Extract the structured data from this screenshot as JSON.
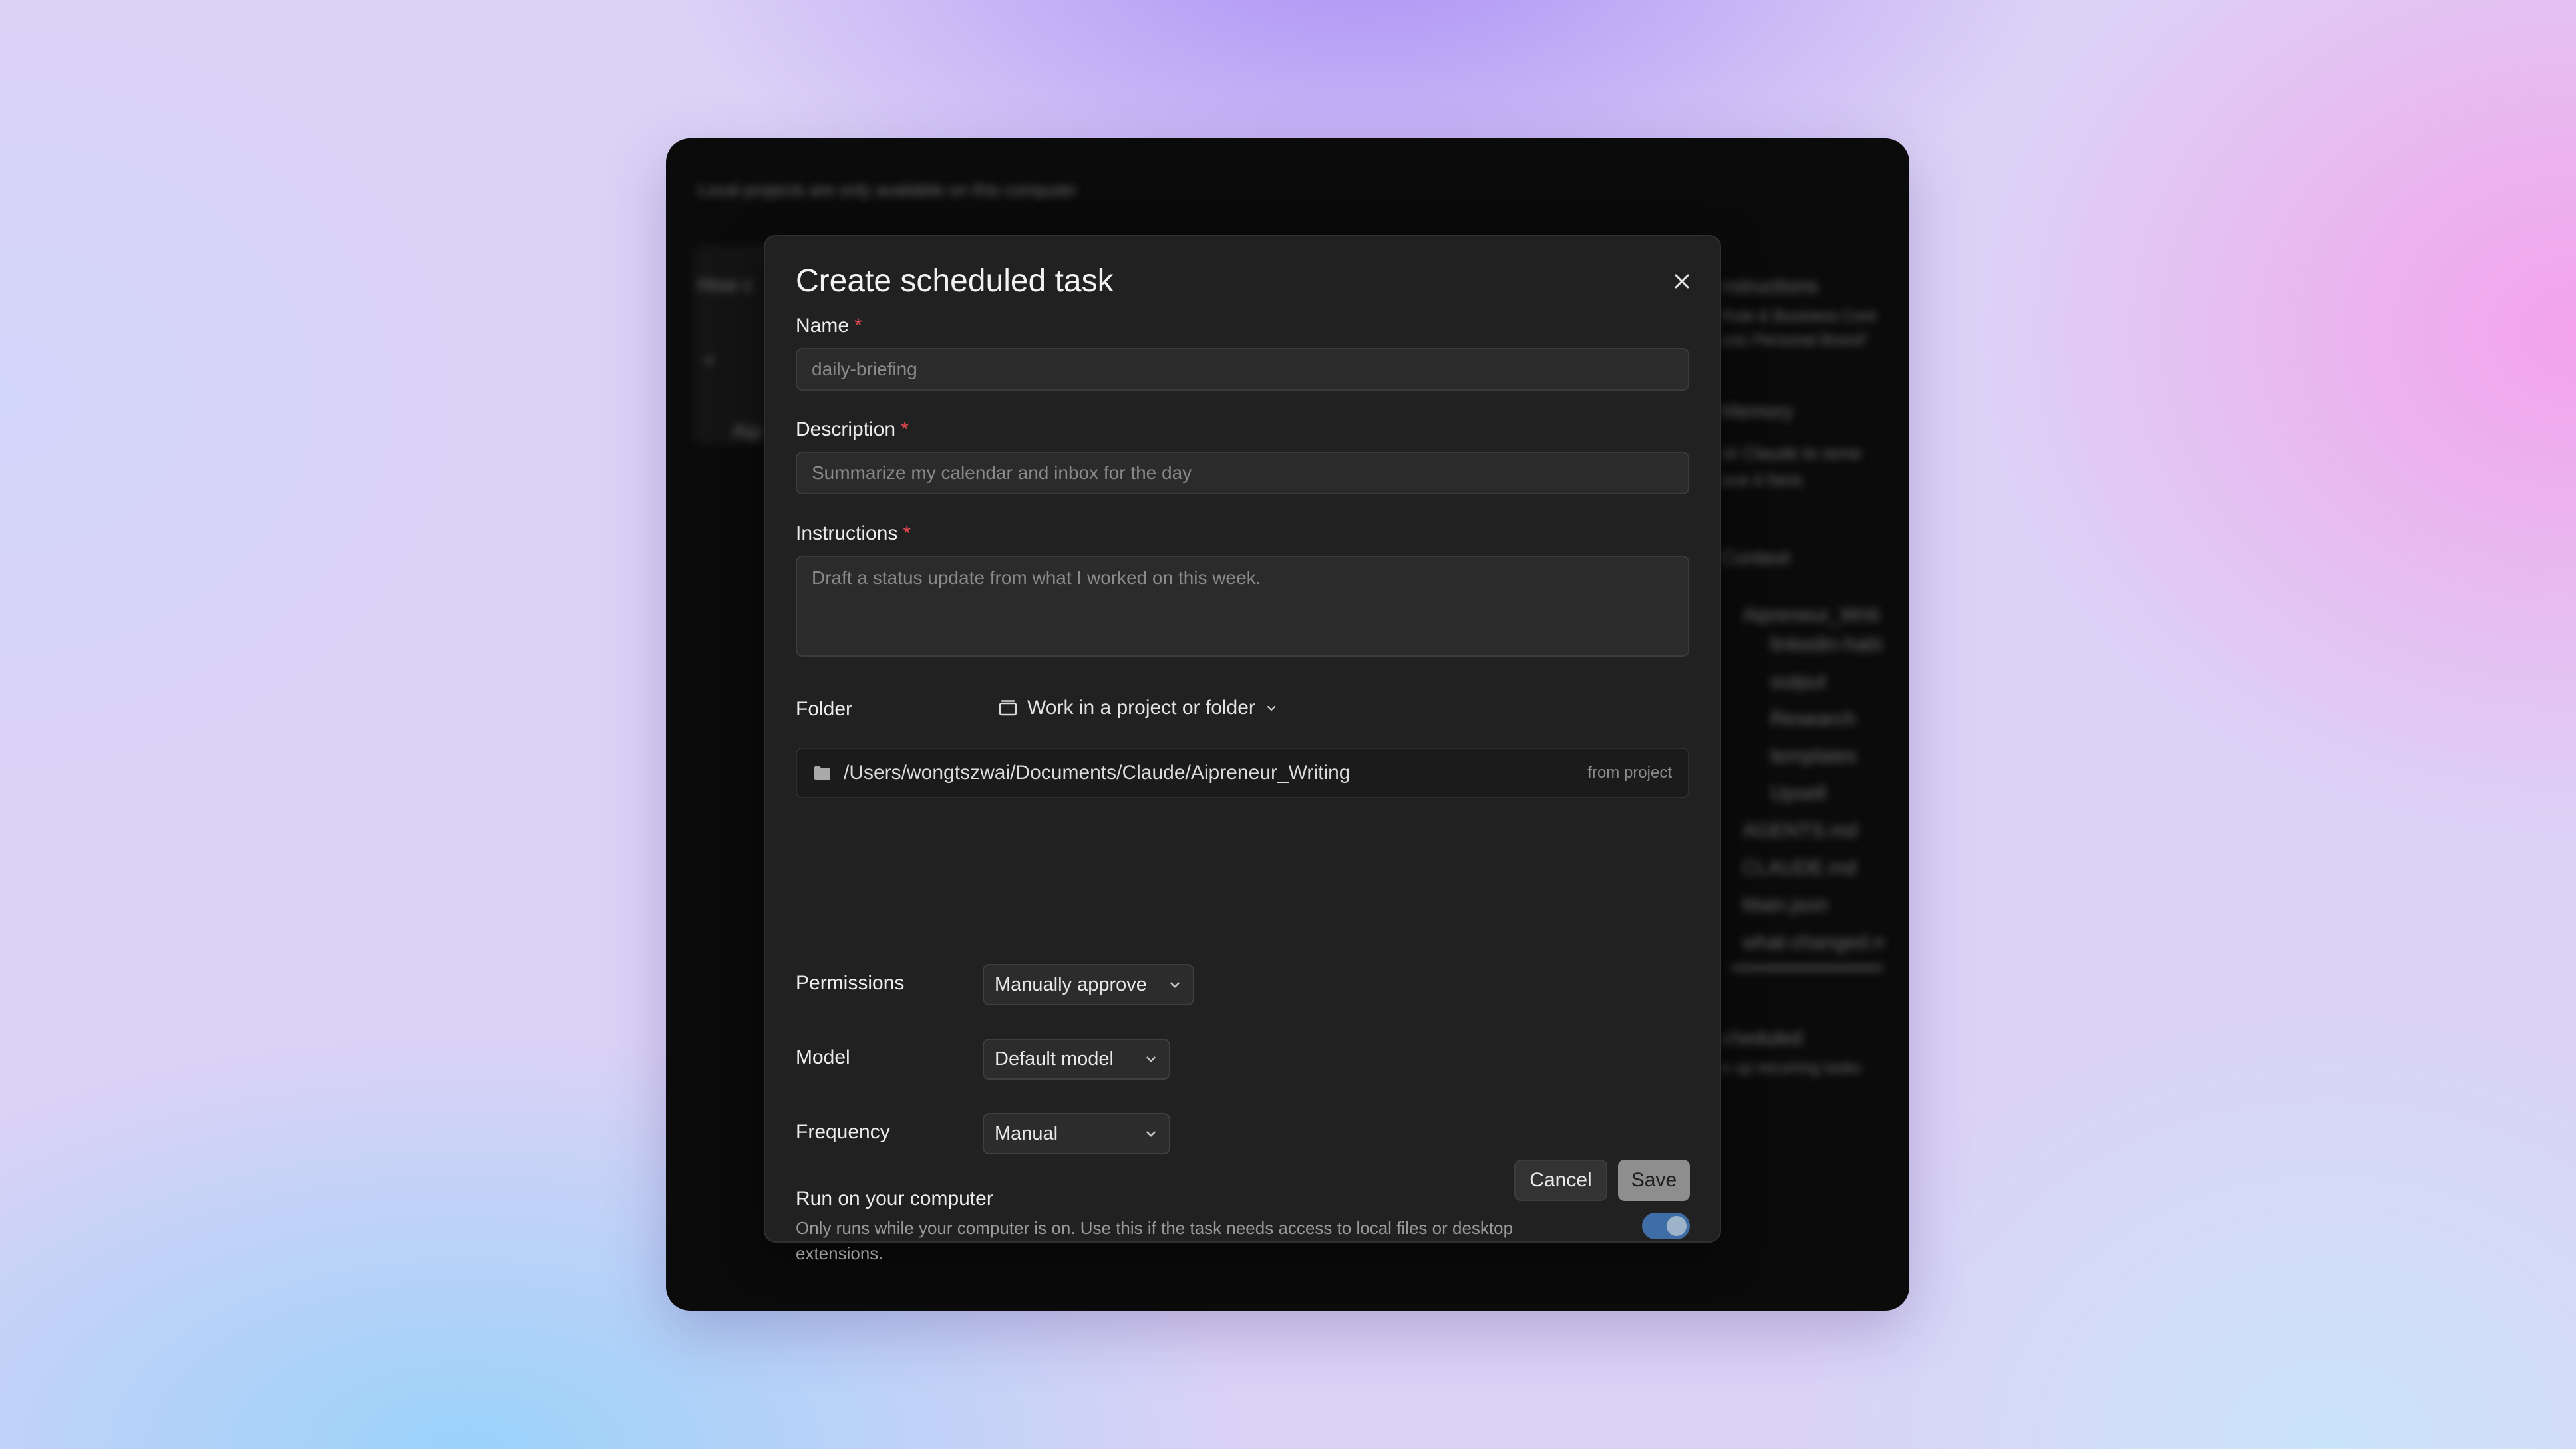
{
  "background_window": {
    "header_text": "Local projects are only available on this computer",
    "left_snippets": [
      "How c",
      "+",
      "Aip"
    ],
    "right_sections": [
      {
        "title": "nstructions",
        "lines": [
          "Role & Business Cont",
          "ssic Personal Brand\""
        ]
      },
      {
        "title": "Memory",
        "lines": [
          "sk Claude to reme",
          "ave it here."
        ]
      },
      {
        "title": "Context",
        "lines": []
      }
    ],
    "context_items": [
      "Aipreneur_Writi",
      "linkedin-habi",
      "output",
      "Research",
      "templates",
      "Upsell",
      "AGENTS.md",
      "CLAUDE.md",
      "Main.json",
      "what-changed.n"
    ],
    "scheduled": {
      "title": "cheduled",
      "line": "e up recurring tasks"
    }
  },
  "dialog": {
    "title": "Create scheduled task",
    "required_mark": "*",
    "name": {
      "label": "Name",
      "placeholder": "daily-briefing"
    },
    "description": {
      "label": "Description",
      "placeholder": "Summarize my calendar and inbox for the day"
    },
    "instructions": {
      "label": "Instructions",
      "placeholder": "Draft a status update from what I worked on this week."
    },
    "folder": {
      "label": "Folder",
      "mode": "Work in a project or folder",
      "path": "/Users/wongtszwai/Documents/Claude/Aipreneur_Writing",
      "path_tag": "from project"
    },
    "permissions": {
      "label": "Permissions",
      "value": "Manually approve"
    },
    "model": {
      "label": "Model",
      "value": "Default model"
    },
    "frequency": {
      "label": "Frequency",
      "value": "Manual"
    },
    "run_local": {
      "title": "Run on your computer",
      "description": "Only runs while your computer is on. Use this if the task needs access to local files or desktop extensions.",
      "enabled": true
    },
    "buttons": {
      "cancel": "Cancel",
      "save": "Save"
    }
  },
  "colors": {
    "modal_bg": "#212121",
    "toggle_on": "#3f6ea6",
    "required": "#e5484d",
    "save_bg": "#8e8e8e"
  }
}
